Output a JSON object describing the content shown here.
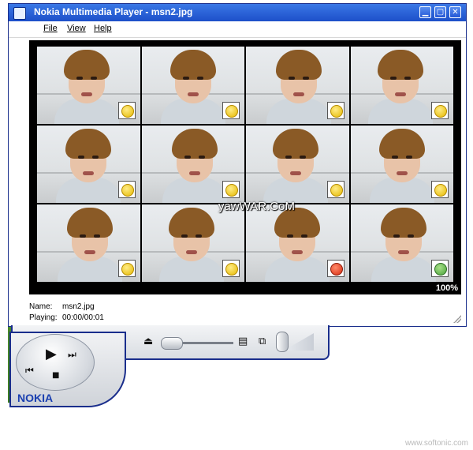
{
  "window": {
    "title": "Nokia Multimedia Player - msn2.jpg",
    "minimize_glyph": "▁",
    "maximize_glyph": "▢",
    "close_glyph": "✕"
  },
  "menu": {
    "file": "File",
    "view": "View",
    "help": "Help"
  },
  "video": {
    "watermark": "yawWAR.CoM",
    "zoom": "100%",
    "emoticons": [
      "smile-icon",
      "smile-icon",
      "wink-icon",
      "surprised-icon",
      "confused-icon",
      "sunglasses-icon",
      "smirk-icon",
      "embarrassed-icon",
      "crying-icon",
      "smile-icon",
      "angry-icon",
      "msn-user-icon"
    ]
  },
  "info": {
    "name_label": "Name:",
    "name_value": "msn2.jpg",
    "playing_label": "Playing:",
    "playing_value": "00:00/00:01"
  },
  "controls": {
    "play_glyph": "▶",
    "next_glyph": "⏭",
    "prev_glyph": "⏮",
    "stop_glyph": "■",
    "eject_glyph": "⏏",
    "playlist_glyph": "▤",
    "window_mode_glyph": "⧉",
    "seek_fraction": 0.0
  },
  "brand": "NOKIA",
  "footer": {
    "url": "www.softonic.com"
  }
}
